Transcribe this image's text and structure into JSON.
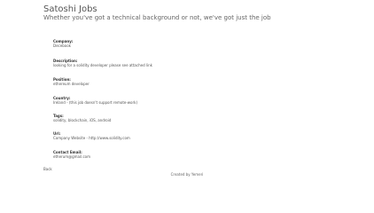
{
  "header": {
    "title": "Satoshi Jobs",
    "tagline": "Whether you've got a technical background or not, we've got just the job"
  },
  "job": {
    "company_label": "Company:",
    "company_value": "Decebook",
    "description_label": "Description:",
    "description_value": "looking for a solidity developer please see attached link",
    "position_label": "Position:",
    "position_value": "ethereum developer",
    "country_label": "Country:",
    "country_value": "Ireland  - (this job doesn't support remote-work)",
    "tags_label": "Tags:",
    "tags_value": "solidity, blockchain, iOS, android",
    "url_label": "Url:",
    "url_value": "Company Website - http://www.solidity.com",
    "email_label": "Contact Email:",
    "email_value": "etherum@gmail.com"
  },
  "nav": {
    "back_label": "Back"
  },
  "footer": {
    "credit": "Created by Yemeri"
  }
}
